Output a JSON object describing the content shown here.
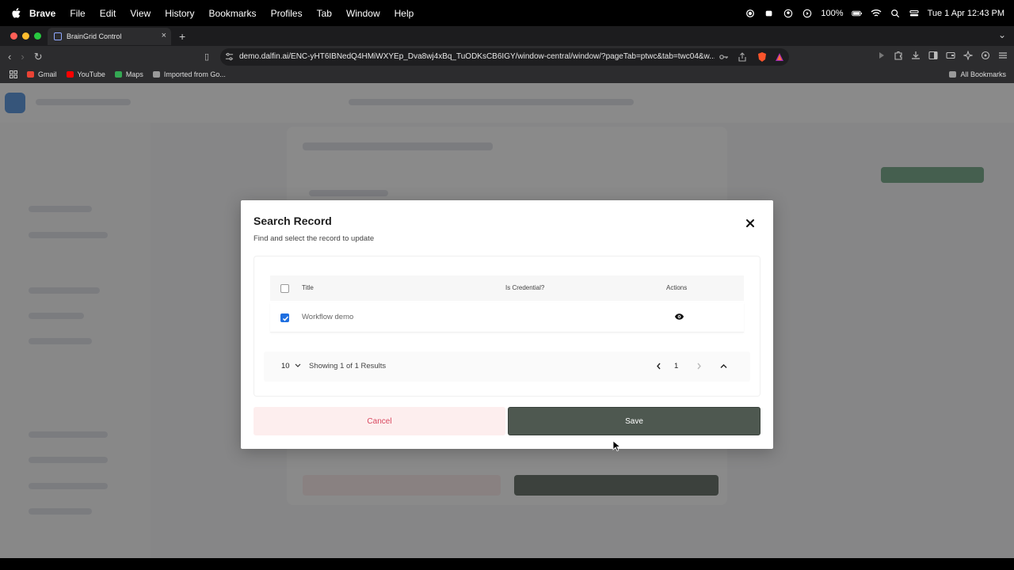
{
  "menubar": {
    "menus": [
      "Brave",
      "File",
      "Edit",
      "View",
      "History",
      "Bookmarks",
      "Profiles",
      "Tab",
      "Window",
      "Help"
    ],
    "battery": "100%",
    "datetime": "Tue 1 Apr  12:43 PM"
  },
  "browser": {
    "tab_title": "BrainGrid Control",
    "url": "demo.dalfin.ai/ENC-yHT6IBNedQ4HMiWXYEp_Dva8wj4xBq_TuODKsCB6IGY/window-central/window/?pageTab=ptwc&tab=twc04&w...",
    "bookmarks": [
      "Gmail",
      "YouTube",
      "Maps",
      "Imported from Go..."
    ],
    "all_bookmarks": "All Bookmarks"
  },
  "dialog": {
    "title": "Search Record",
    "subtitle": "Find and select the record to update",
    "table": {
      "headers": [
        "Title",
        "Is Credential?",
        "Actions"
      ],
      "rows": [
        {
          "title": "Workflow demo",
          "is_credential": "",
          "checked": true
        }
      ]
    },
    "pagination": {
      "page_size": "10",
      "showing": "Showing 1 of 1 Results",
      "page": "1"
    },
    "cancel_label": "Cancel",
    "save_label": "Save"
  },
  "colors": {
    "accent": "#1f6fe0",
    "save_bg": "#4e5850",
    "cancel_bg": "#fdeeee",
    "cancel_text": "#d9485f"
  }
}
